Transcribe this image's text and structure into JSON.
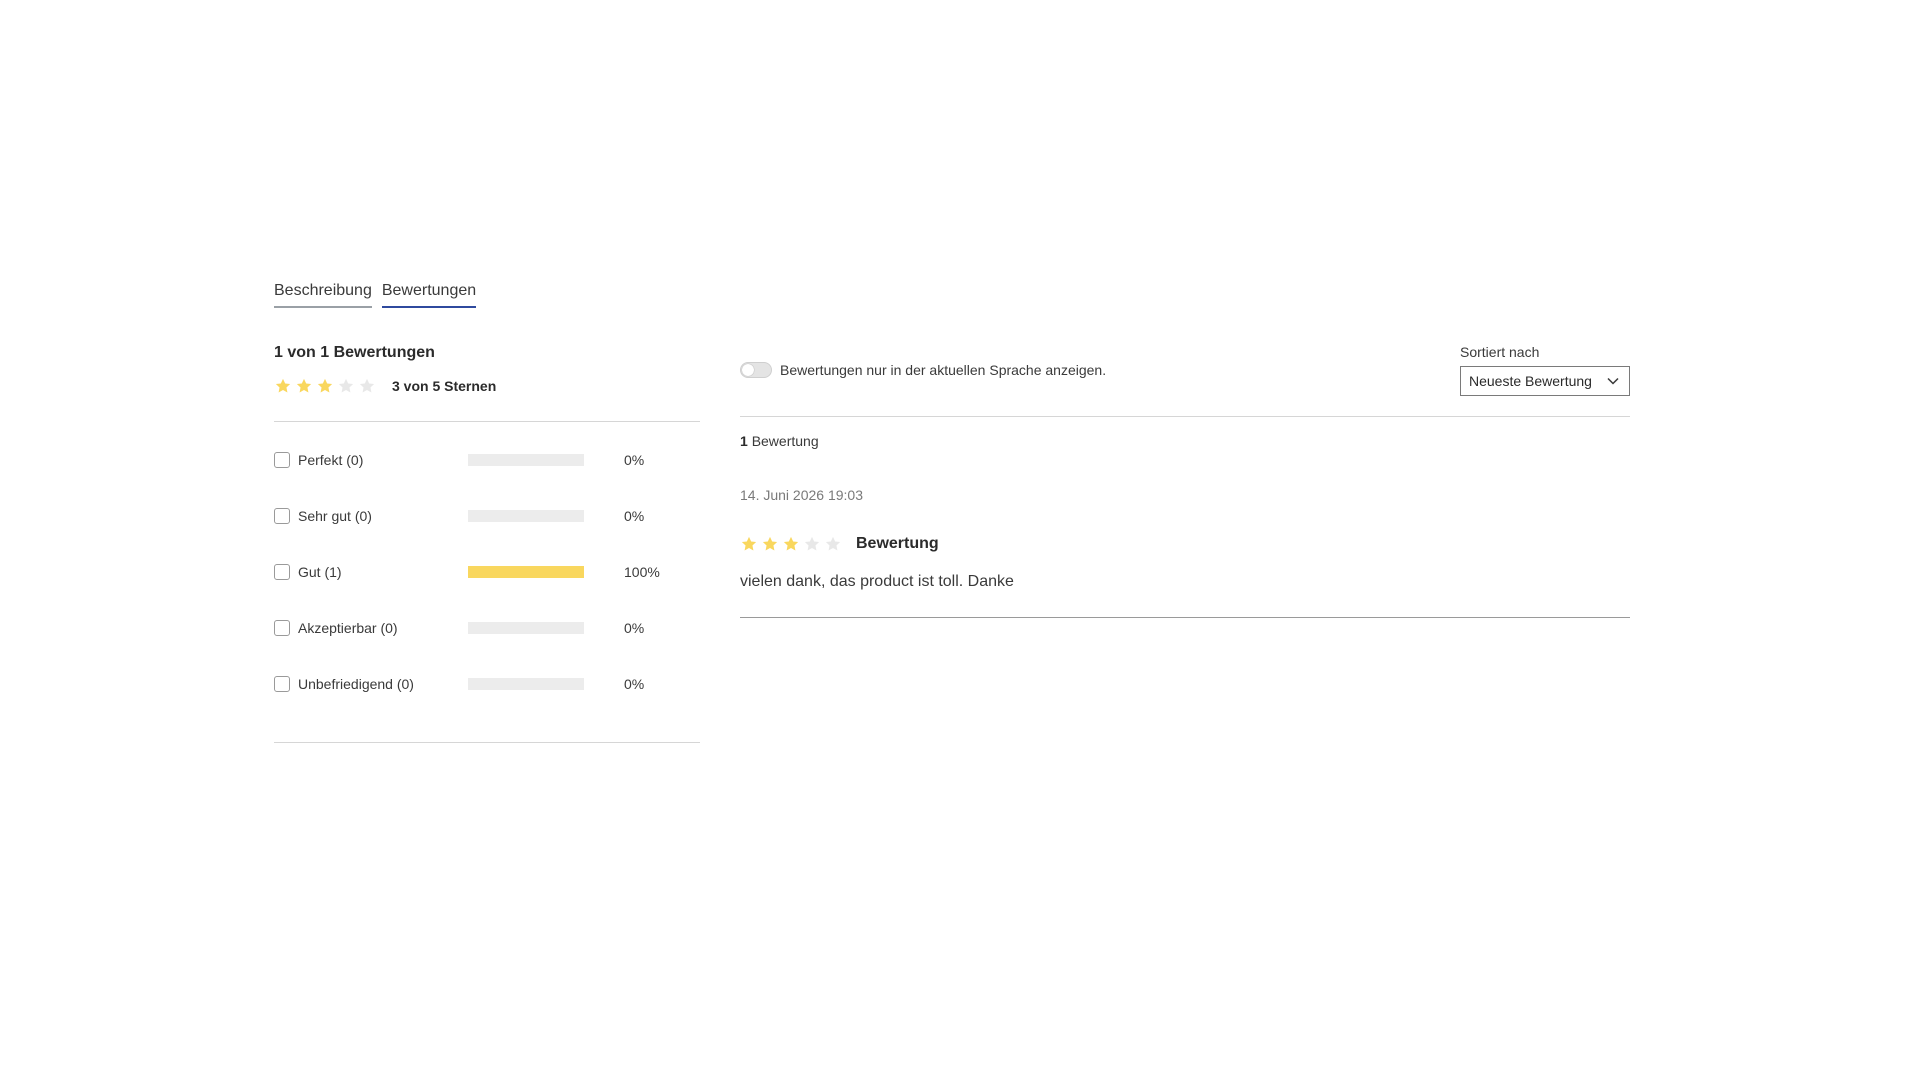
{
  "tabs": [
    {
      "label": "Beschreibung",
      "active": false
    },
    {
      "label": "Bewertungen",
      "active": true
    }
  ],
  "summary": {
    "title": "1 von 1 Bewertungen",
    "rating": 3,
    "max_rating": 5,
    "rating_text": "3 von 5 Sternen"
  },
  "filters": [
    {
      "label": "Perfekt (0)",
      "fraction": 0,
      "percent": "0%"
    },
    {
      "label": "Sehr gut (0)",
      "fraction": 0,
      "percent": "0%"
    },
    {
      "label": "Gut (1)",
      "fraction": 1,
      "percent": "100%"
    },
    {
      "label": "Akzeptierbar (0)",
      "fraction": 0,
      "percent": "0%"
    },
    {
      "label": "Unbefriedigend (0)",
      "fraction": 0,
      "percent": "0%"
    }
  ],
  "toolbar": {
    "language_toggle_label": "Bewertungen nur in der aktuellen Sprache anzeigen.",
    "language_toggle_on": false,
    "sort_label": "Sortiert nach",
    "sort_value": "Neueste Bewertung"
  },
  "reviews_count": {
    "number": "1",
    "label": "Bewertung"
  },
  "review": {
    "date": "14. Juni 2026 19:03",
    "rating": 3,
    "title": "Bewertung",
    "text": "vielen dank, das product ist toll. Danke"
  },
  "colors": {
    "star_filled": "#f9d75e",
    "star_empty": "#e8e8e8",
    "active_tab": "#2f4a9e",
    "bar_fill": "#f9d75e"
  },
  "icons": {
    "star": "star-icon",
    "chevron": "chevron-down-icon"
  }
}
